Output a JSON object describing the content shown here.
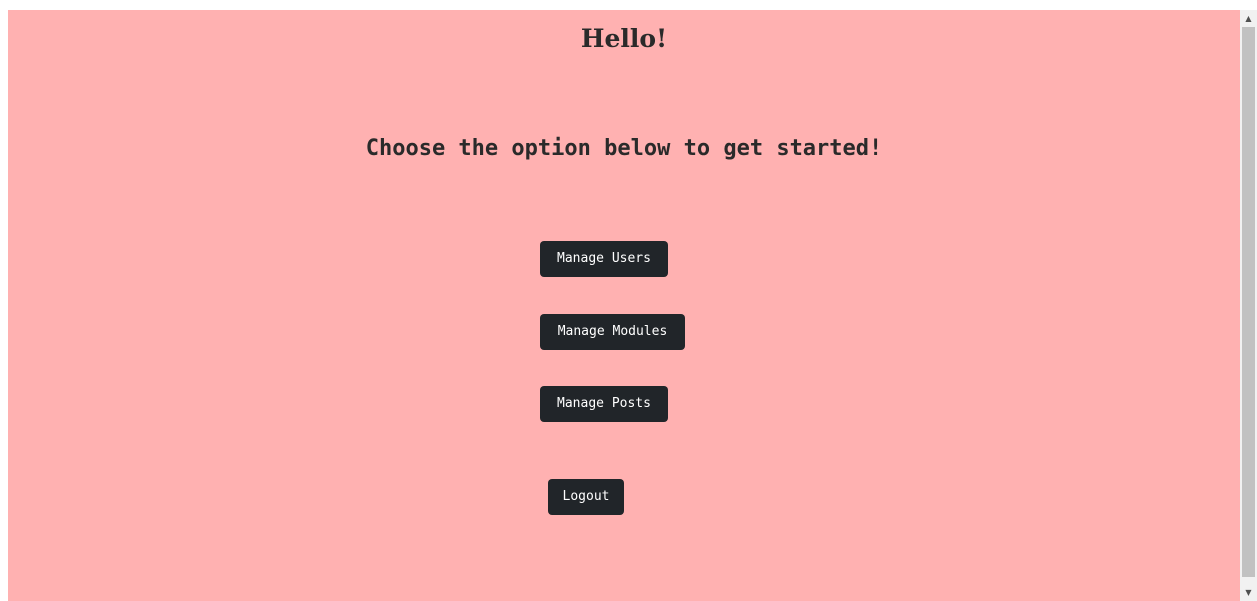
{
  "page": {
    "background_color": "#ffb1b1",
    "greeting": "Hello!",
    "subtitle": "Choose the option below to get started!"
  },
  "buttons": {
    "manage_users": "Manage Users",
    "manage_modules": "Manage Modules",
    "manage_posts": "Manage Posts",
    "logout": "Logout",
    "button_color": "#212529"
  },
  "scrollbar": {
    "up_icon": "scroll-up-arrow",
    "down_icon": "scroll-down-arrow"
  }
}
